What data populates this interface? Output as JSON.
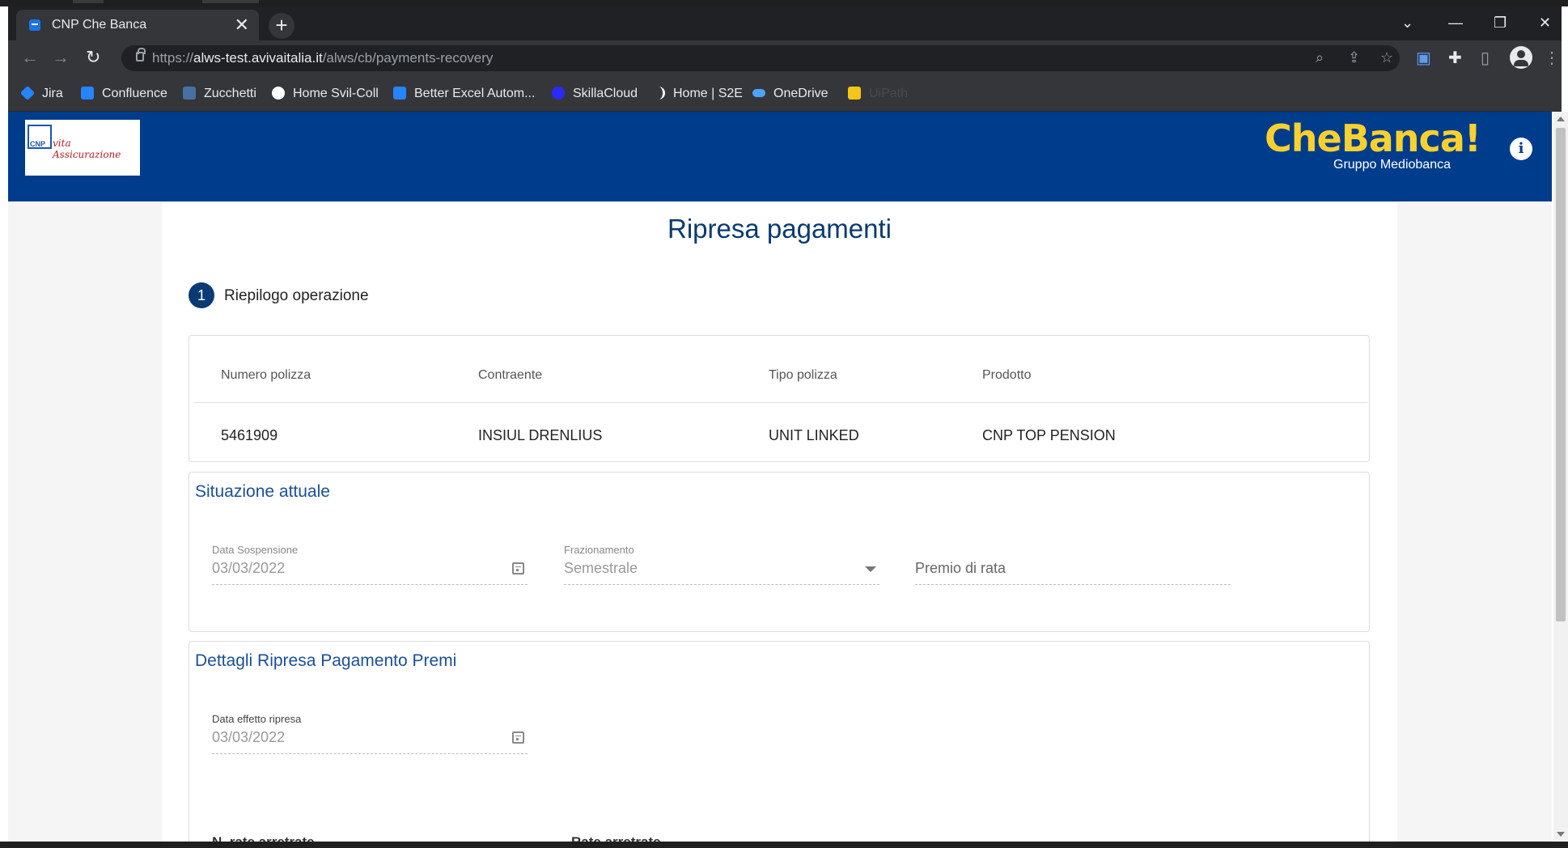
{
  "browser": {
    "tab_title": "CNP Che Banca",
    "tab_close": "✕",
    "new_tab": "+",
    "url_scheme": "https://",
    "url_host": "alws-test.avivaitalia.it",
    "url_path": "/alws/cb/payments-recovery",
    "bookmarks": [
      {
        "label": "Jira",
        "color": "#2684ff"
      },
      {
        "label": "Confluence",
        "color": "#2684ff"
      },
      {
        "label": "Zucchetti",
        "color": "#4a6fa5"
      },
      {
        "label": "Home Svil-Coll",
        "color": "#ffffff"
      },
      {
        "label": "Better Excel Autom...",
        "color": "#2684ff"
      },
      {
        "label": "SkillaCloud",
        "color": "#2a2aff"
      },
      {
        "label": "Home | S2E",
        "color": "#ffffff"
      },
      {
        "label": "OneDrive",
        "color": "#4da3ff"
      },
      {
        "label": "UiPath",
        "color": "#f5c518"
      }
    ]
  },
  "header": {
    "logo_cnp": "CNP",
    "logo_script": "vita Assicurazione",
    "brand": "CheBanca!",
    "group": "Gruppo Mediobanca",
    "info_glyph": "i"
  },
  "main": {
    "title": "Ripresa pagamenti",
    "step_number": "1",
    "step_label": "Riepilogo operazione",
    "summary": {
      "headers": [
        "Numero polizza",
        "Contraente",
        "Tipo polizza",
        "Prodotto"
      ],
      "values": [
        "5461909",
        "INSIUL DRENLIUS",
        "UNIT LINKED",
        "CNP TOP PENSION"
      ]
    },
    "situazione": {
      "title": "Situazione attuale",
      "data_sospensione_label": "Data Sospensione",
      "data_sospensione_value": "03/03/2022",
      "frazionamento_label": "Frazionamento",
      "frazionamento_value": "Semestrale",
      "premio_placeholder": "Premio di rata"
    },
    "dettagli": {
      "title": "Dettagli Ripresa Pagamento Premi",
      "data_effetto_label": "Data effetto ripresa",
      "data_effetto_value": "03/03/2022",
      "n_rate_label": "N. rate arretrate",
      "rate_label": "Rate arretrate"
    }
  },
  "colors": {
    "header_bg": "#003c8c",
    "brand_yellow": "#f8d12f",
    "title_blue": "#0a3a73"
  }
}
